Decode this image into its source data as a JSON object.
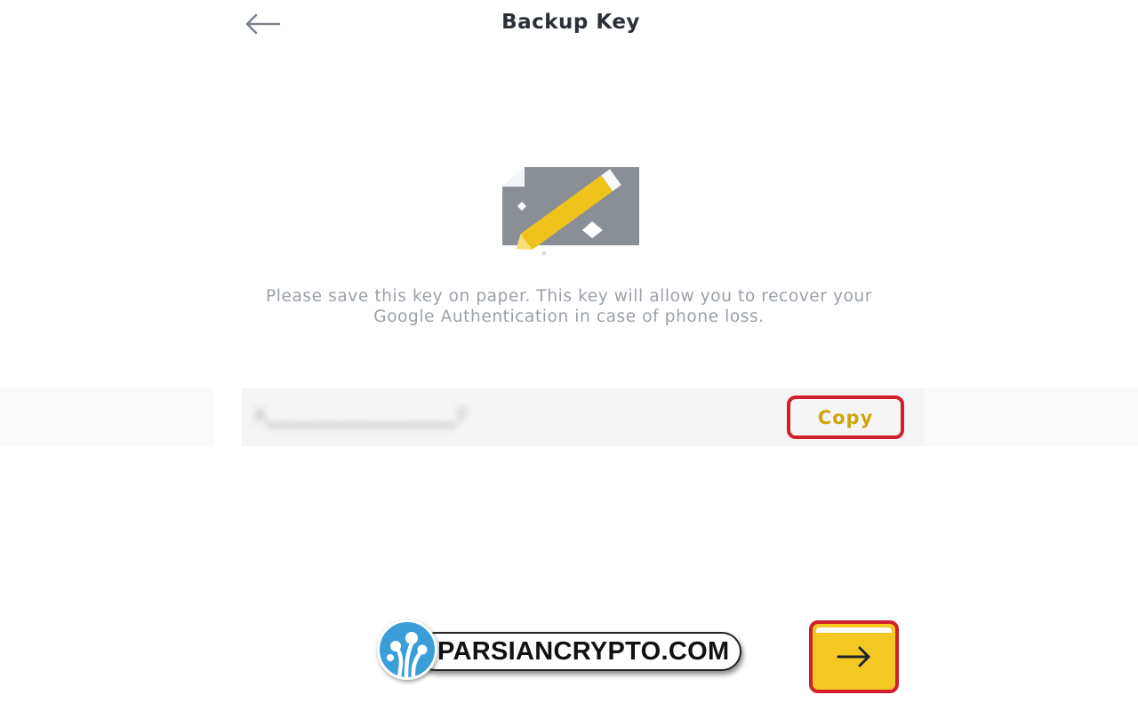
{
  "header": {
    "title": "Backup Key",
    "back_icon": "arrow-left-icon"
  },
  "illustration": {
    "icon": "paper-pencil-icon",
    "colors": {
      "paper": "#8a8f96",
      "pencil": "#f0c31c",
      "fold": "#e6e8ea"
    }
  },
  "info": {
    "text": "Please save this key on paper. This key will allow you to recover your Google Authentication in case of phone loss."
  },
  "backup_key": {
    "value": "A▁▁▁▁▁▁▁▁▁▁▁▁▁▁▁F",
    "copy_label": "Copy"
  },
  "watermark": {
    "text": "PARSIANCRYPTO.COM",
    "logo_icon": "tree-logo-icon"
  },
  "next_button": {
    "icon": "arrow-right-icon"
  },
  "colors": {
    "accent": "#f4c823",
    "copy_text": "#d0a50c",
    "highlight_border": "#d11f2b",
    "muted_text": "#9aa0a8"
  }
}
